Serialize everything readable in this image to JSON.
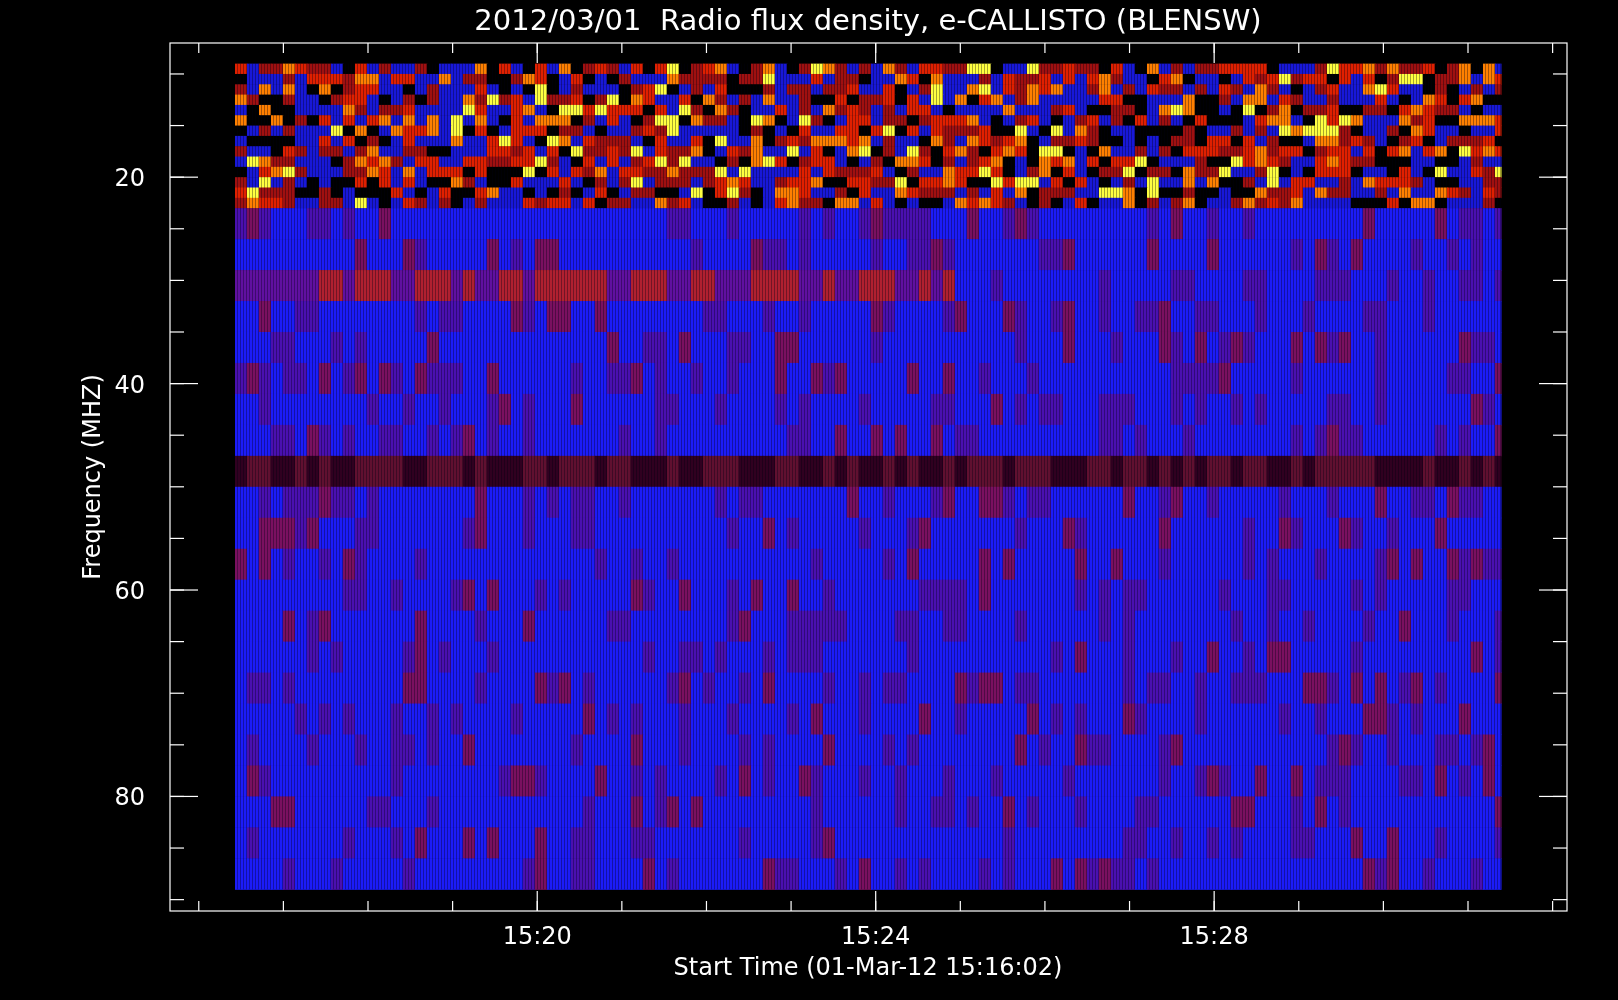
{
  "title": "2012/03/01  Radio flux density, e-CALLISTO (BLENSW)",
  "plot": {
    "xlabel": "Start Time (01-Mar-12 15:16:02)",
    "ylabel": "Frequency (MHZ)",
    "xticks": [
      "15:20",
      "15:24",
      "15:28"
    ],
    "yticks": [
      "20",
      "40",
      "60",
      "80"
    ]
  }
}
